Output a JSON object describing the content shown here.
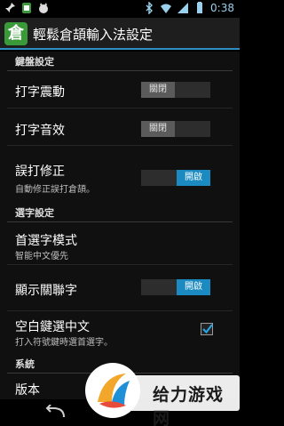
{
  "status_bar": {
    "time": "0:38",
    "left_icons": [
      "pin-icon",
      "android-icon",
      "cat-icon"
    ],
    "right_icons": [
      "bluetooth-icon",
      "wifi-icon",
      "signal-icon",
      "battery-icon"
    ]
  },
  "action_bar": {
    "app_icon_glyph": "倉",
    "title": "輕鬆倉頡輸入法設定"
  },
  "sections": {
    "keyboard": "鍵盤設定",
    "selection": "選字設定",
    "system": "系統"
  },
  "prefs": {
    "vibrate": {
      "title": "打字震動",
      "toggle": "關閉",
      "state": "off"
    },
    "sound": {
      "title": "打字音效",
      "toggle": "關閉",
      "state": "off"
    },
    "correction": {
      "title": "誤打修正",
      "summary": "自動修正誤打倉頡。",
      "toggle": "開啟",
      "state": "on"
    },
    "first_choice": {
      "title": "首選字模式",
      "summary": "智能中文優先"
    },
    "related": {
      "title": "顯示關聯字",
      "toggle": "開啟",
      "state": "on"
    },
    "space_select": {
      "title": "空白鍵選中文",
      "summary": "打入符號鍵時選首選字。",
      "checked": true
    },
    "version": {
      "title": "版本"
    }
  },
  "watermark": {
    "text": "给力游戏网"
  },
  "colors": {
    "accent": "#1b8ac1",
    "app_icon": "#3a9a3a"
  }
}
